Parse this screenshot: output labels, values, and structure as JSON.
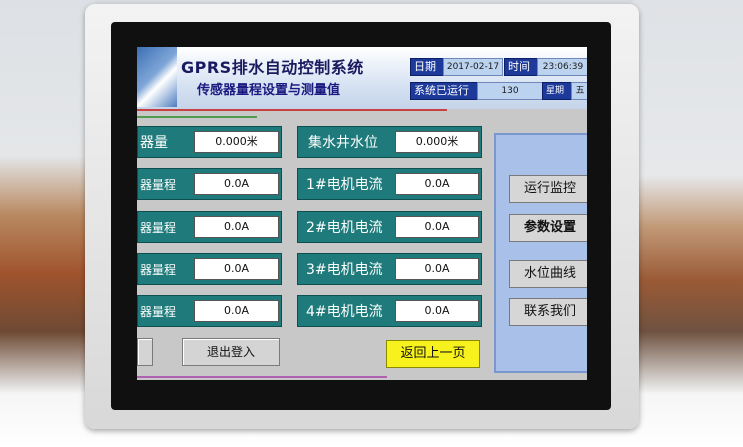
{
  "header": {
    "title": "GPRS排水自动控制系统",
    "subtitle": "传感器量程设置与测量值",
    "date_label": "日期",
    "date_value": "2017-02-17",
    "time_label": "时间",
    "time_value": "23:06:39",
    "runtime_label": "系统已运行",
    "runtime_value": "130",
    "weekday_label": "星期",
    "weekday_value": "五"
  },
  "left_rows": [
    {
      "label": "器量",
      "value": "0.000米"
    },
    {
      "label": "器量程",
      "value": "0.0A"
    },
    {
      "label": "器量程",
      "value": "0.0A"
    },
    {
      "label": "器量程",
      "value": "0.0A"
    },
    {
      "label": "器量程",
      "value": "0.0A"
    }
  ],
  "right_rows": [
    {
      "label": "集水井水位",
      "value": "0.000米"
    },
    {
      "label": "1#电机电流",
      "value": "0.0A"
    },
    {
      "label": "2#电机电流",
      "value": "0.0A"
    },
    {
      "label": "3#电机电流",
      "value": "0.0A"
    },
    {
      "label": "4#电机电流",
      "value": "0.0A"
    }
  ],
  "buttons": {
    "logout": "退出登入",
    "back": "返回上一页"
  },
  "side_nav": [
    "运行监控",
    "参数设置",
    "水位曲线",
    "联系我们"
  ],
  "colors": {
    "row_teal": "#1f7b7b",
    "header_blue": "#1d3a9b",
    "back_yellow": "#f7f21d",
    "side_panel": "#a9c0e8"
  }
}
